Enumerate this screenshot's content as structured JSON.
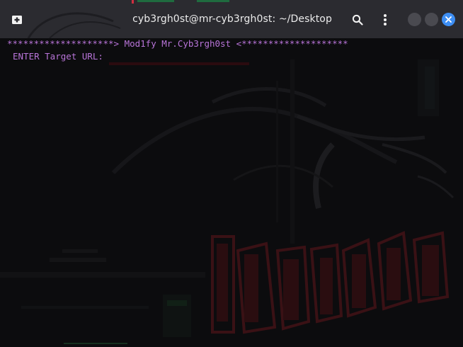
{
  "window": {
    "title": "cyb3rgh0st@mr-cyb3rgh0st: ~/Desktop"
  },
  "titlebar": {
    "new_tab_icon": "new-tab-icon",
    "search_icon": "search-icon",
    "menu_icon": "kebab-menu-icon",
    "minimize_icon": "minimize-icon",
    "maximize_icon": "maximize-icon",
    "close_icon": "close-icon"
  },
  "terminal": {
    "banner": "********************> Mod1fy Mr.Cyb3rgh0st <********************",
    "prompt": "ENTER Target URL: ",
    "text_color": "#b874d8"
  },
  "colors": {
    "titlebar_bg": "#2b2b30",
    "terminal_bg": "#0c0c0e",
    "accent_close": "#3d8ef3",
    "wallpaper_red": "#4a1418"
  }
}
